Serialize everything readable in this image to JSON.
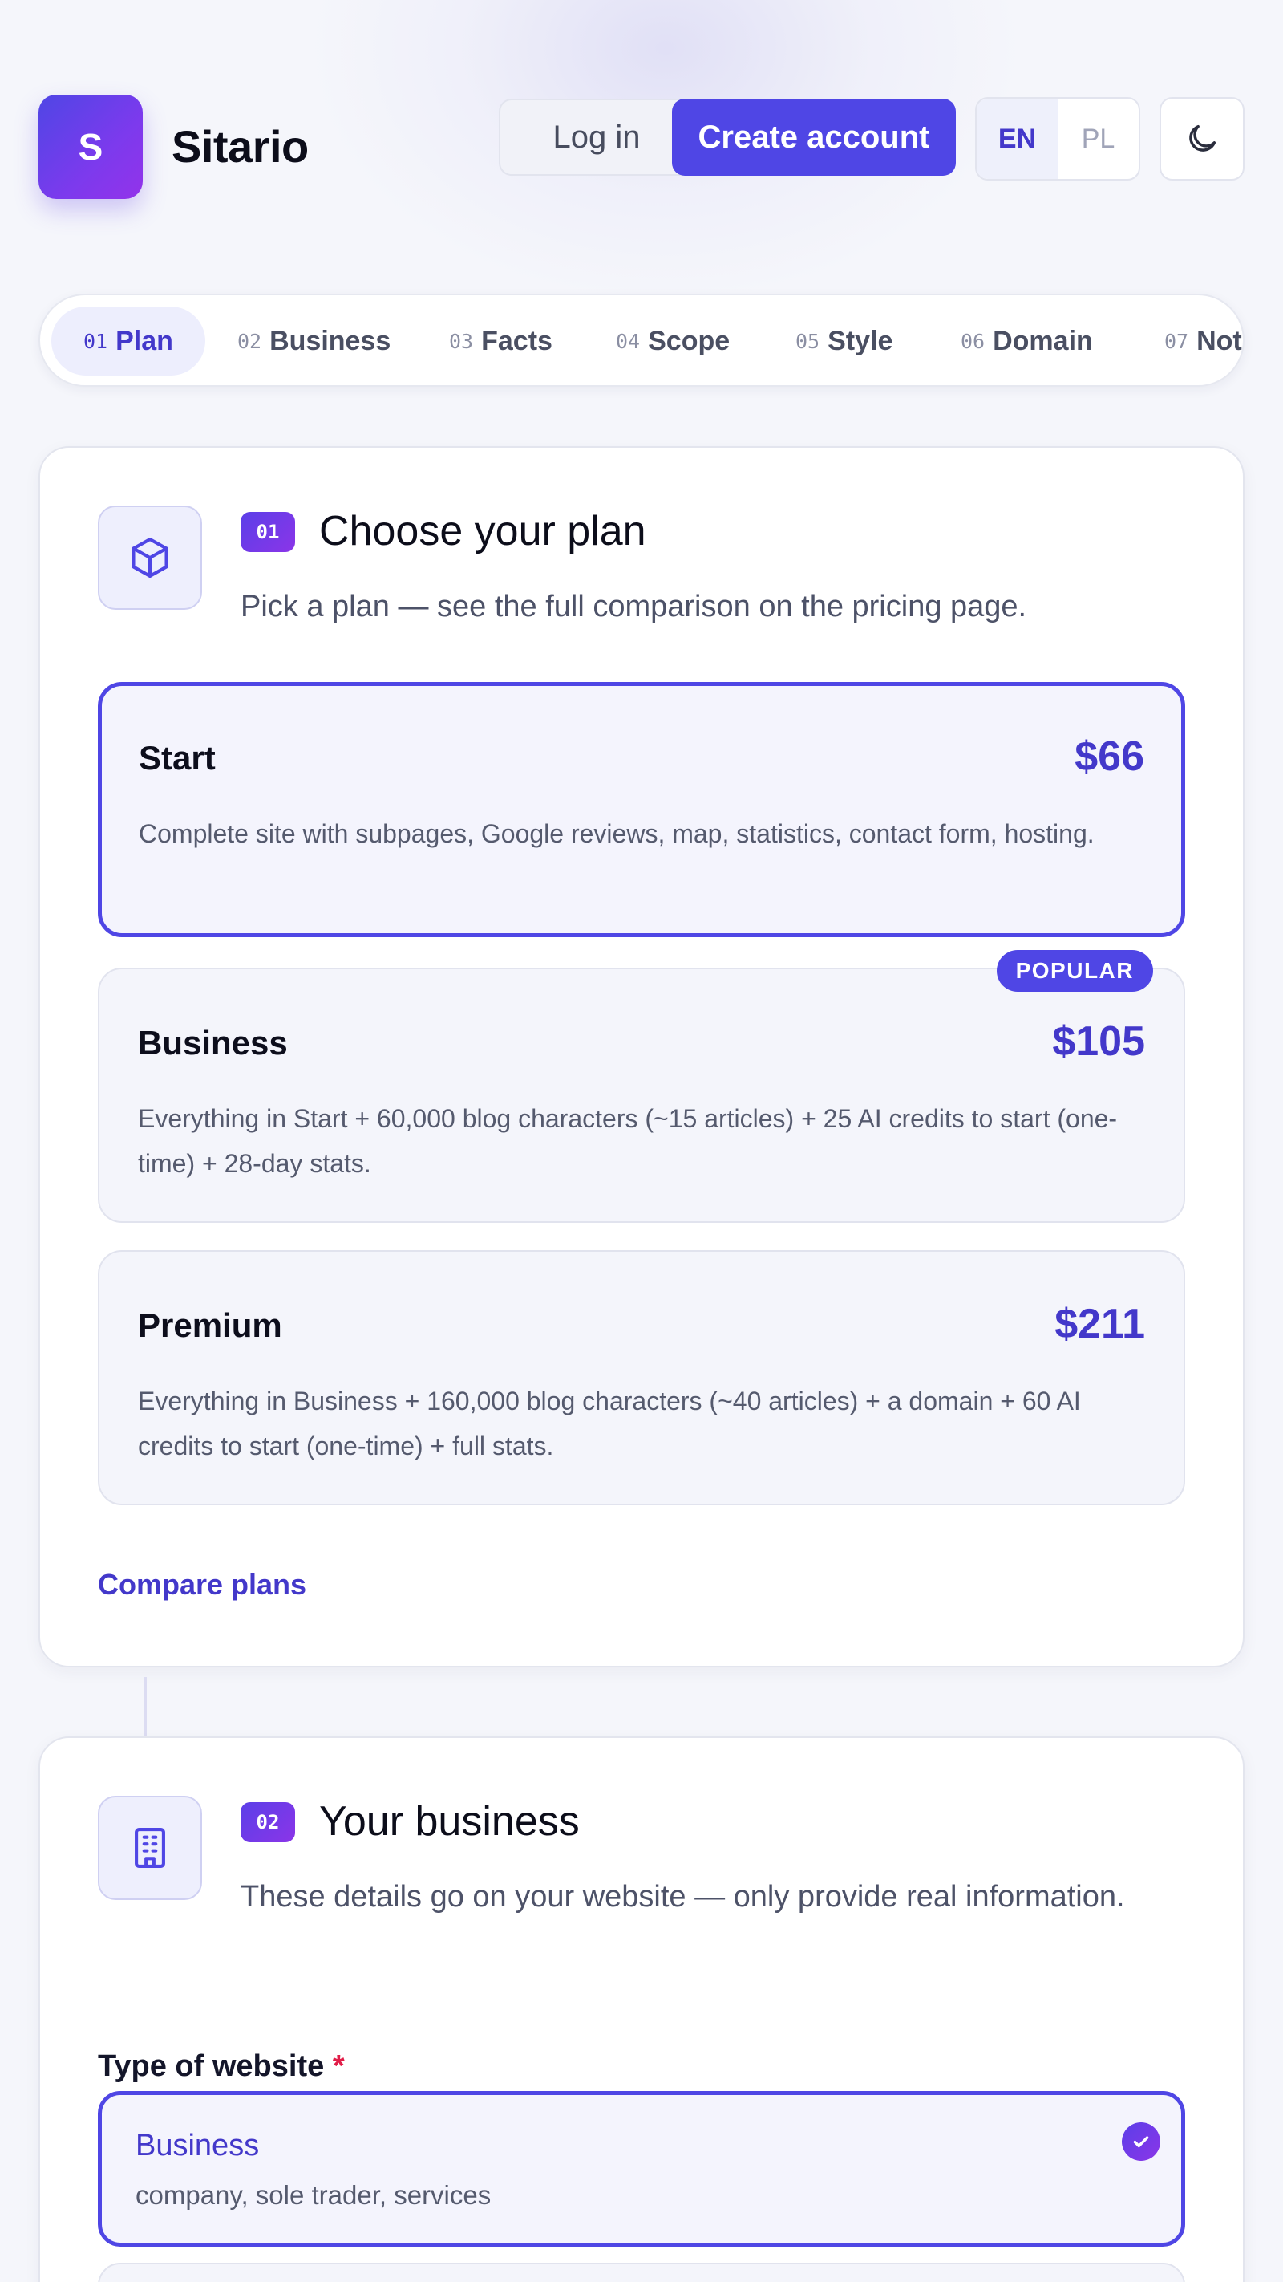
{
  "brand": {
    "initial": "S",
    "name": "Sitario"
  },
  "header": {
    "login_label": "Log in",
    "create_label": "Create account",
    "languages": [
      "EN",
      "PL"
    ],
    "active_language": "EN",
    "theme_icon": "moon-icon"
  },
  "stepper": {
    "steps": [
      {
        "num": "01",
        "label": "Plan"
      },
      {
        "num": "02",
        "label": "Business"
      },
      {
        "num": "03",
        "label": "Facts"
      },
      {
        "num": "04",
        "label": "Scope"
      },
      {
        "num": "05",
        "label": "Style"
      },
      {
        "num": "06",
        "label": "Domain"
      },
      {
        "num": "07",
        "label": "Not"
      }
    ],
    "active_index": 0
  },
  "plan_section": {
    "badge": "01",
    "icon": "cube-icon",
    "title": "Choose your plan",
    "subtitle": "Pick a plan — see the full comparison on the pricing page.",
    "plans": [
      {
        "name": "Start",
        "price": "$66",
        "description": "Complete site with subpages, Google reviews, map, statistics, contact form, hosting."
      },
      {
        "name": "Business",
        "price": "$105",
        "description": "Everything in Start + 60,000 blog characters (~15 articles) + 25 AI credits to start (one-time) + 28-day stats.",
        "badge": "POPULAR"
      },
      {
        "name": "Premium",
        "price": "$211",
        "description": "Everything in Business + 160,000 blog characters (~40 articles) + a domain + 60 AI credits to start (one-time) + full stats."
      }
    ],
    "selected_plan": "Start",
    "compare_label": "Compare plans"
  },
  "business_section": {
    "badge": "02",
    "icon": "building-icon",
    "title": "Your business",
    "subtitle": "These details go on your website — only provide real information.",
    "field_label": "Type of website",
    "required_mark": "*",
    "options": [
      {
        "title": "Business",
        "subtitle": "company, sole trader, services",
        "selected": true
      }
    ]
  },
  "colors": {
    "accent": "#4f46e5",
    "accent_text": "#4338ca",
    "required": "#e11d48"
  }
}
